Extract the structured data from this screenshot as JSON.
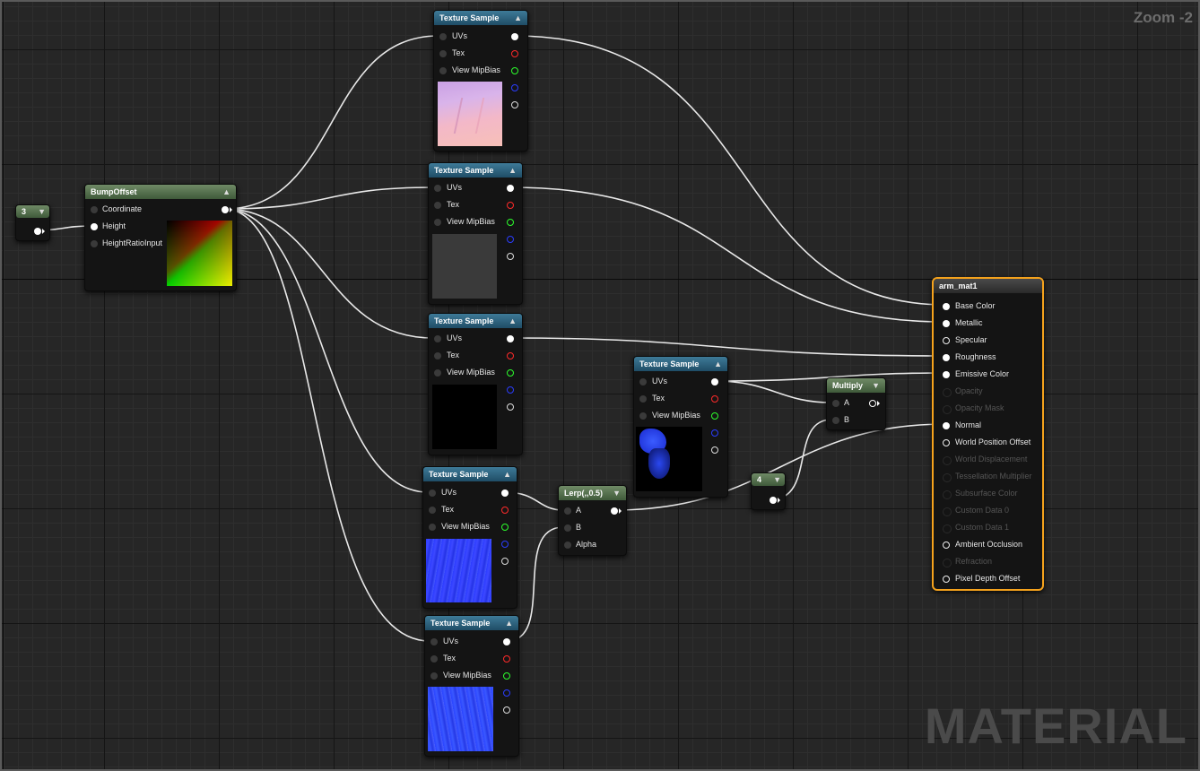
{
  "zoom_label": "Zoom -2",
  "watermark": "MATERIAL",
  "colors": {
    "texture_header": "#2f6580",
    "math_header": "#5a7352",
    "material_border": "#f5a21c",
    "wire": "#e8e8e8"
  },
  "nodes": {
    "const3": {
      "value": "3"
    },
    "bumpoffset": {
      "title": "BumpOffset",
      "inputs": [
        "Coordinate",
        "Height",
        "HeightRatioInput"
      ]
    },
    "tex1": {
      "title": "Texture Sample",
      "inputs": [
        "UVs",
        "Tex",
        "View MipBias"
      ],
      "preview": "pink-normal-texture"
    },
    "tex2": {
      "title": "Texture Sample",
      "inputs": [
        "UVs",
        "Tex",
        "View MipBias"
      ],
      "preview": "grey-texture"
    },
    "tex3": {
      "title": "Texture Sample",
      "inputs": [
        "UVs",
        "Tex",
        "View MipBias"
      ],
      "preview": "black-texture"
    },
    "tex4": {
      "title": "Texture Sample",
      "inputs": [
        "UVs",
        "Tex",
        "View MipBias"
      ],
      "preview": "blue-normal-texture"
    },
    "tex5": {
      "title": "Texture Sample",
      "inputs": [
        "UVs",
        "Tex",
        "View MipBias"
      ],
      "preview": "blue-normal-texture"
    },
    "tex6": {
      "title": "Texture Sample",
      "inputs": [
        "UVs",
        "Tex",
        "View MipBias"
      ],
      "preview": "blue-mask-texture"
    },
    "lerp": {
      "title": "Lerp(,,0.5)",
      "inputs": [
        "A",
        "B",
        "Alpha"
      ]
    },
    "multiply": {
      "title": "Multiply",
      "inputs": [
        "A",
        "B"
      ]
    },
    "const4": {
      "value": "4"
    },
    "material": {
      "title": "arm_mat1",
      "inputs": [
        {
          "label": "Base Color",
          "enabled": true
        },
        {
          "label": "Metallic",
          "enabled": true
        },
        {
          "label": "Specular",
          "enabled": true
        },
        {
          "label": "Roughness",
          "enabled": true
        },
        {
          "label": "Emissive Color",
          "enabled": true
        },
        {
          "label": "Opacity",
          "enabled": false
        },
        {
          "label": "Opacity Mask",
          "enabled": false
        },
        {
          "label": "Normal",
          "enabled": true
        },
        {
          "label": "World Position Offset",
          "enabled": true
        },
        {
          "label": "World Displacement",
          "enabled": false
        },
        {
          "label": "Tessellation Multiplier",
          "enabled": false
        },
        {
          "label": "Subsurface Color",
          "enabled": false
        },
        {
          "label": "Custom Data 0",
          "enabled": false
        },
        {
          "label": "Custom Data 1",
          "enabled": false
        },
        {
          "label": "Ambient Occlusion",
          "enabled": true
        },
        {
          "label": "Refraction",
          "enabled": false
        },
        {
          "label": "Pixel Depth Offset",
          "enabled": true
        }
      ]
    }
  }
}
